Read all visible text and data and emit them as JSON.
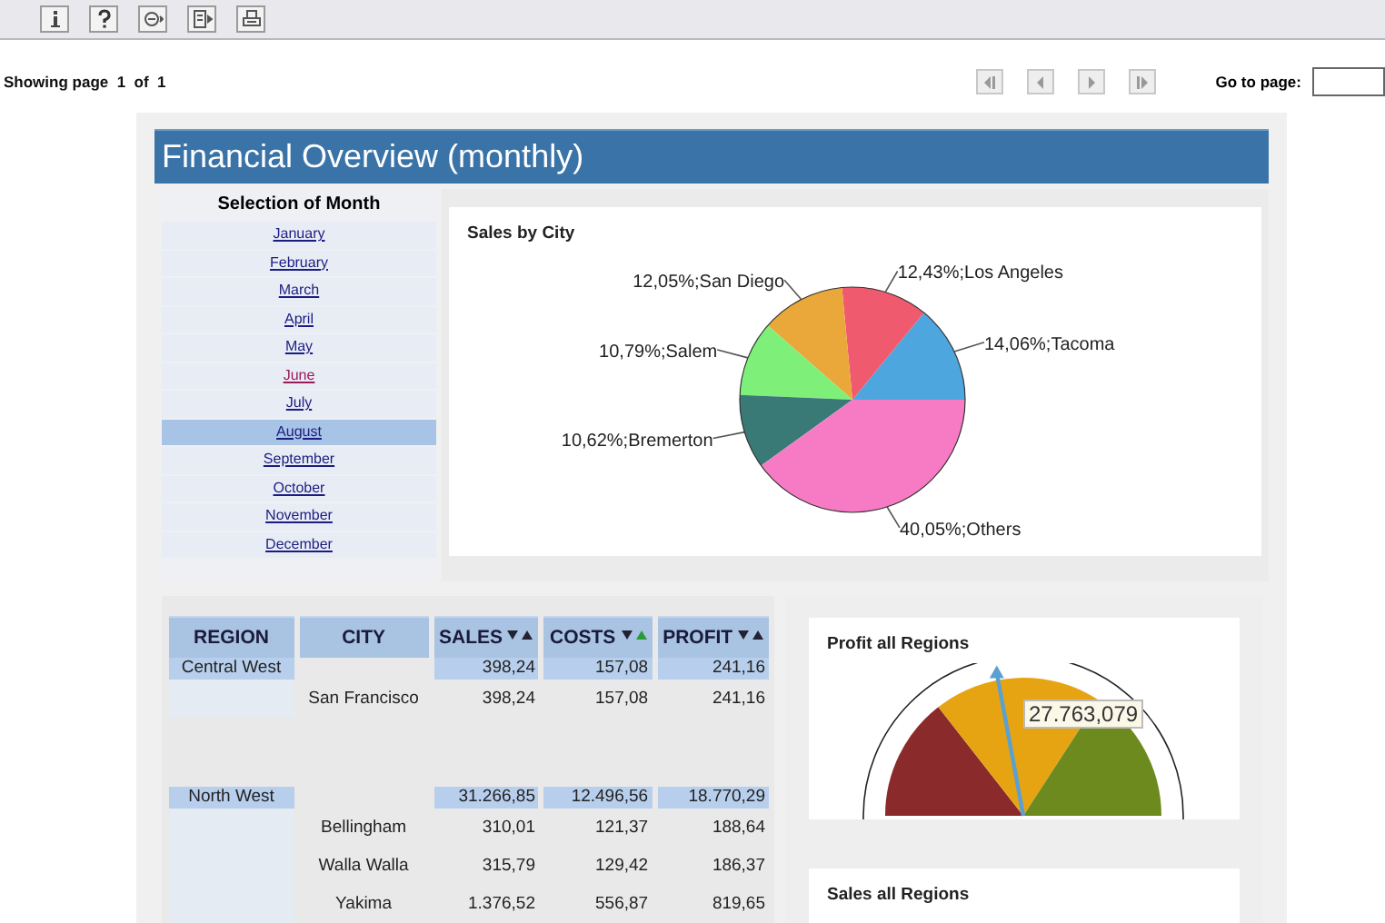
{
  "toolbar": {
    "buttons": [
      {
        "kind": "info"
      },
      {
        "kind": "help"
      },
      {
        "kind": "export"
      },
      {
        "kind": "layout"
      },
      {
        "kind": "print"
      }
    ]
  },
  "pager": {
    "showing": "Showing page",
    "page": "1",
    "of": "of",
    "total": "1",
    "goto_label": "Go to page:"
  },
  "report": {
    "title": "Financial Overview (monthly)",
    "months": {
      "heading": "Selection of Month",
      "items": [
        {
          "label": "January",
          "selected": false,
          "visited": false
        },
        {
          "label": "February",
          "selected": false,
          "visited": false
        },
        {
          "label": "March",
          "selected": false,
          "visited": false
        },
        {
          "label": "April",
          "selected": false,
          "visited": false
        },
        {
          "label": "May",
          "selected": false,
          "visited": false
        },
        {
          "label": "June",
          "selected": false,
          "visited": true
        },
        {
          "label": "July",
          "selected": false,
          "visited": false
        },
        {
          "label": "August",
          "selected": true,
          "visited": false
        },
        {
          "label": "September",
          "selected": false,
          "visited": false
        },
        {
          "label": "October",
          "selected": false,
          "visited": false
        },
        {
          "label": "November",
          "selected": false,
          "visited": false
        },
        {
          "label": "December",
          "selected": false,
          "visited": false
        }
      ]
    },
    "sales_by_city": {
      "chart_data": {
        "type": "pie",
        "title": "Sales by City",
        "categories": [
          "14,06%;Tacoma",
          "12,43%;Los Angeles",
          "12,05%;San Diego",
          "10,79%;Salem",
          "10,62%;Bremerton",
          "40,05%;Others"
        ],
        "values": [
          14.06,
          12.43,
          12.05,
          10.79,
          10.62,
          40.05
        ],
        "colors": [
          "#4ea6de",
          "#f05a6e",
          "#eaa83a",
          "#7ef07a",
          "#3a7a76",
          "#f77bc4"
        ]
      }
    },
    "table": {
      "columns": [
        {
          "label": "REGION"
        },
        {
          "label": "CITY"
        },
        {
          "label": "SALES",
          "sorted": false
        },
        {
          "label": "COSTS",
          "sorted": true
        },
        {
          "label": "PROFIT",
          "sorted": false
        }
      ],
      "rows": [
        {
          "kind": "region",
          "cells": [
            "Central West",
            "",
            "398,24",
            "157,08",
            "241,16"
          ]
        },
        {
          "kind": "city",
          "cells": [
            "",
            "San Francisco",
            "398,24",
            "157,08",
            "241,16"
          ]
        },
        {
          "kind": "spacer",
          "cells": []
        },
        {
          "kind": "region",
          "cells": [
            "North West",
            "",
            "31.266,85",
            "12.496,56",
            "18.770,29"
          ]
        },
        {
          "kind": "city",
          "cells": [
            "",
            "Bellingham",
            "310,01",
            "121,37",
            "188,64"
          ]
        },
        {
          "kind": "city",
          "cells": [
            "",
            "Walla Walla",
            "315,79",
            "129,42",
            "186,37"
          ]
        },
        {
          "kind": "city",
          "cells": [
            "",
            "Yakima",
            "1.376,52",
            "556,87",
            "819,65"
          ]
        }
      ]
    },
    "profit_gauge": {
      "title": "Profit all Regions",
      "value": "27.763,079"
    },
    "sales_gauge": {
      "title": "Sales all Regions"
    }
  }
}
